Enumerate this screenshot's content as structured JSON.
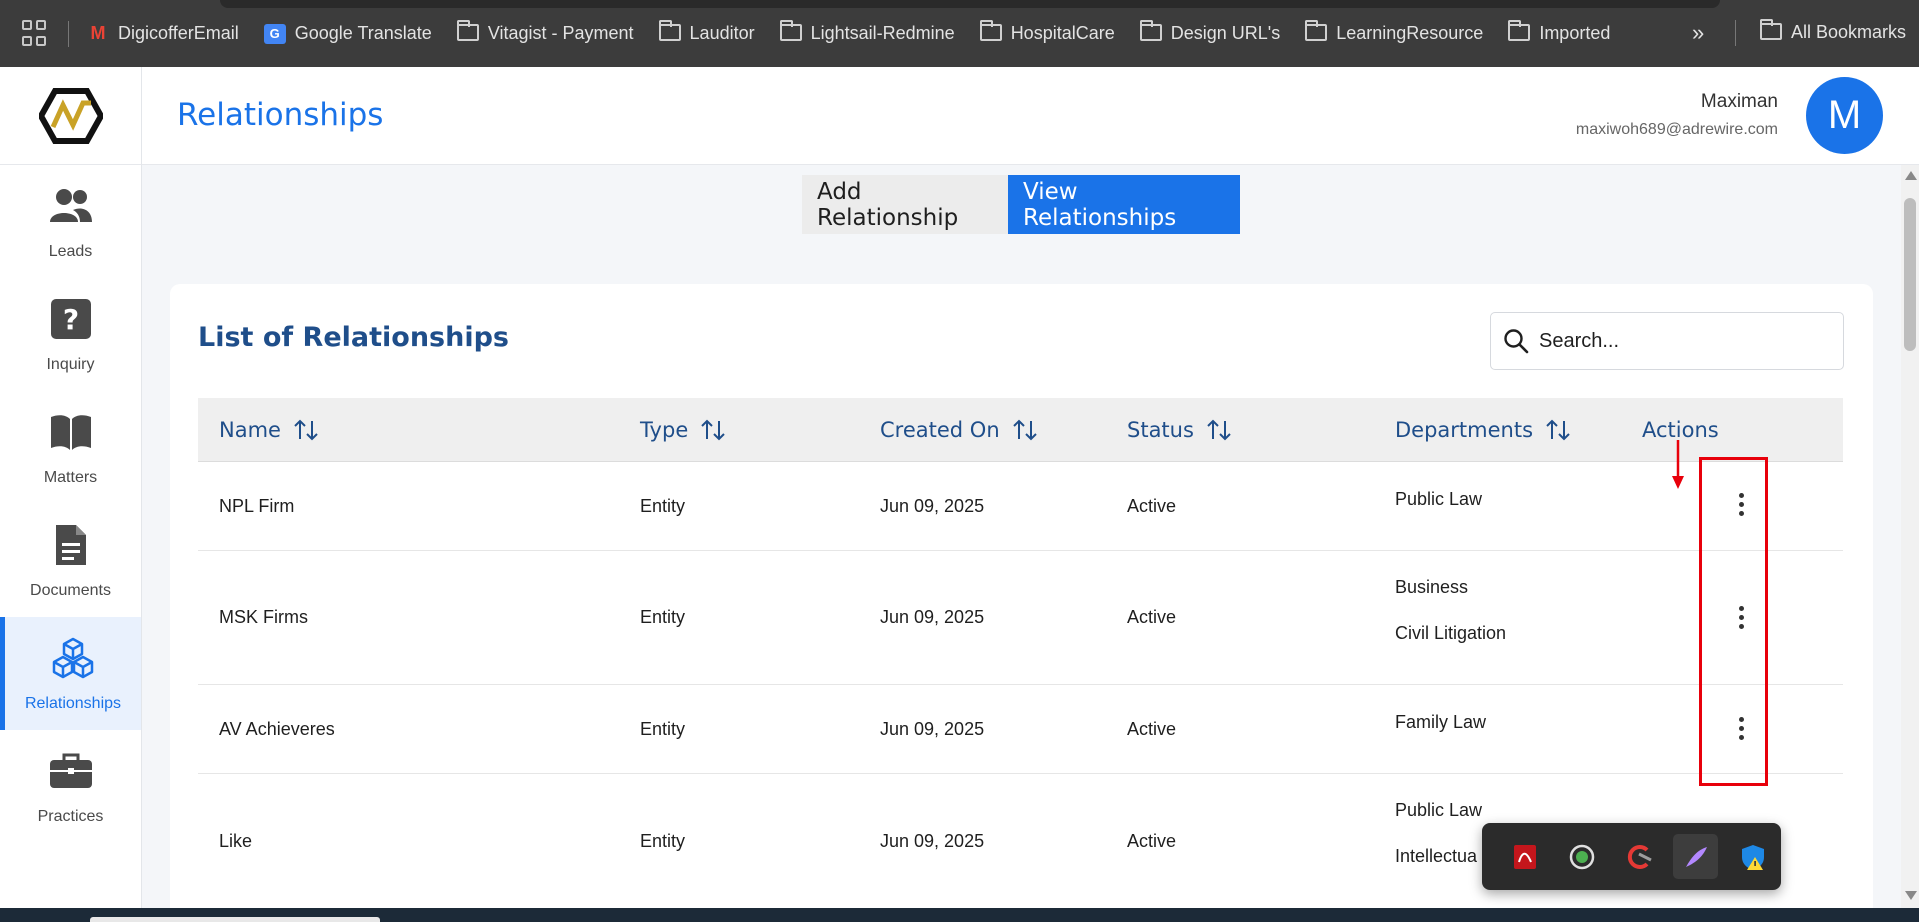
{
  "bookmarks": {
    "items": [
      {
        "label": "DigicofferEmail",
        "icon": "gmail-icon"
      },
      {
        "label": "Google Translate",
        "icon": "google-translate-icon"
      },
      {
        "label": "Vitagist - Payment",
        "icon": "folder-icon"
      },
      {
        "label": "Lauditor",
        "icon": "folder-icon"
      },
      {
        "label": "Lightsail-Redmine",
        "icon": "folder-icon"
      },
      {
        "label": "HospitalCare",
        "icon": "folder-icon"
      },
      {
        "label": "Design URL's",
        "icon": "folder-icon"
      },
      {
        "label": "LearningResource",
        "icon": "folder-icon"
      },
      {
        "label": "Imported",
        "icon": "folder-icon"
      }
    ],
    "more": "»",
    "all_bookmarks": "All Bookmarks"
  },
  "sidebar": {
    "items": [
      {
        "label": "Leads",
        "icon": "people-icon"
      },
      {
        "label": "Inquiry",
        "icon": "question-icon"
      },
      {
        "label": "Matters",
        "icon": "book-icon"
      },
      {
        "label": "Documents",
        "icon": "document-icon"
      },
      {
        "label": "Relationships",
        "icon": "cubes-icon",
        "active": true
      },
      {
        "label": "Practices",
        "icon": "briefcase-icon"
      }
    ]
  },
  "header": {
    "title": "Relationships",
    "user_name": "Maximan",
    "user_email": "maxiwoh689@adrewire.com",
    "avatar_letter": "M"
  },
  "toggle": {
    "add_label": "Add Relationship",
    "view_label": "View Relationships"
  },
  "list": {
    "title": "List of Relationships",
    "search_placeholder": "Search...",
    "columns": [
      "Name",
      "Type",
      "Created On",
      "Status",
      "Departments",
      "Actions"
    ],
    "rows": [
      {
        "name": "NPL Firm",
        "type": "Entity",
        "created_on": "Jun 09, 2025",
        "status": "Active",
        "departments": [
          "Public Law"
        ]
      },
      {
        "name": "MSK Firms",
        "type": "Entity",
        "created_on": "Jun 09, 2025",
        "status": "Active",
        "departments": [
          "Business",
          "Civil Litigation"
        ]
      },
      {
        "name": "AV Achieveres",
        "type": "Entity",
        "created_on": "Jun 09, 2025",
        "status": "Active",
        "departments": [
          "Family Law"
        ]
      },
      {
        "name": "Like",
        "type": "Entity",
        "created_on": "Jun 09, 2025",
        "status": "Active",
        "departments": [
          "Public Law",
          "Intellectua"
        ]
      }
    ]
  },
  "colors": {
    "accent": "#1a73e8",
    "heading": "#1f4e8a",
    "annotation": "#e8000b"
  },
  "tray": {
    "icons": [
      "pdf-icon",
      "record-icon",
      "ccleaner-icon",
      "feather-icon",
      "defender-icon"
    ]
  }
}
